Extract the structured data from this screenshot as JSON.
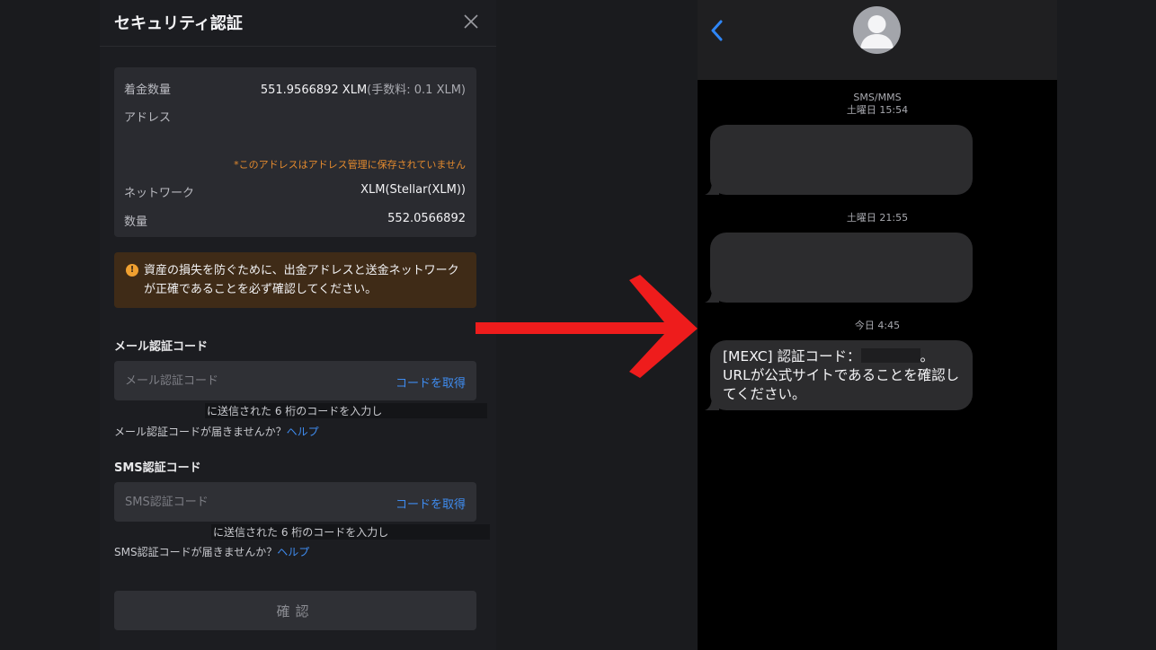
{
  "modal": {
    "title": "セキュリティ認証",
    "info": {
      "received_label": "着金数量",
      "received_value": "551.9566892 XLM",
      "received_fee": "(手数料: 0.1 XLM)",
      "address_label": "アドレス",
      "address_note": "*このアドレスはアドレス管理に保存されていません",
      "network_label": "ネットワーク",
      "network_value": "XLM(Stellar(XLM))",
      "amount_label": "数量",
      "amount_value": "552.0566892"
    },
    "warning": "資産の損失を防ぐために、出金アドレスと送金ネットワークが正確であることを必ず確認してください。",
    "email": {
      "label": "メール認証コード",
      "placeholder": "メール認証コード",
      "get_code": "コードを取得",
      "hint": "に送信された 6 桁のコードを入力し",
      "help_question": "メール認証コードが届きませんか？",
      "help_link": "ヘルプ"
    },
    "sms": {
      "label": "SMS認証コード",
      "placeholder": "SMS認証コード",
      "get_code": "コードを取得",
      "hint": "に送信された 6 桁のコードを入力し",
      "help_question": "SMS認証コードが届きませんか？",
      "help_link": "ヘルプ"
    },
    "confirm_label": "確認",
    "colors": {
      "link": "#3f8cf0",
      "warning_bg": "#3f2b17",
      "note": "#e38a2e"
    }
  },
  "arrow": {
    "color": "#ee1c1c"
  },
  "phone": {
    "service_label": "SMS/MMS",
    "timestamps": [
      "土曜日 15:54",
      "土曜日 21:55",
      "今日 4:45"
    ],
    "message_prefix": "[MEXC] 認証コード：",
    "message_suffix": "。",
    "message_rest": "URLが公式サイトであることを確認してください。"
  }
}
